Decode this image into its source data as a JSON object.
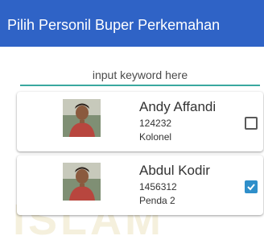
{
  "appbar": {
    "title": "Pilih Personil Buper Perkemahan"
  },
  "search": {
    "placeholder": "input keyword here",
    "value": ""
  },
  "personnel": [
    {
      "name": "Andy Affandi",
      "id_number": "124232",
      "rank": "Kolonel",
      "selected": false
    },
    {
      "name": "Abdul Kodir",
      "id_number": "1456312",
      "rank": "Penda 2",
      "selected": true
    }
  ],
  "watermark": {
    "text": "ISLAM"
  },
  "colors": {
    "primary": "#2f63c6",
    "accent": "#3aa8a0",
    "checkbox_checked": "#2f8fca"
  }
}
